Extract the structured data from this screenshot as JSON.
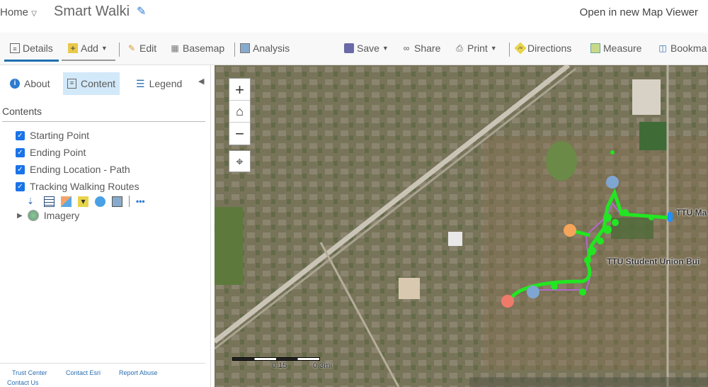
{
  "header": {
    "home": "Home",
    "title": "Smart Walki",
    "open_viewer": "Open in new Map Viewer"
  },
  "toolbar": {
    "details": "Details",
    "add": "Add",
    "edit": "Edit",
    "basemap": "Basemap",
    "analysis": "Analysis",
    "save": "Save",
    "share": "Share",
    "print": "Print",
    "directions": "Directions",
    "measure": "Measure",
    "bookmarks": "Bookma"
  },
  "sidebar": {
    "tabs": [
      "About",
      "Content",
      "Legend"
    ],
    "contents_heading": "Contents",
    "layers": [
      "Starting Point",
      "Ending Point",
      "Ending Location - Path",
      "Tracking Walking Routes"
    ],
    "basemap_layer": "Imagery",
    "footer": [
      "Trust Center",
      "Contact Esri",
      "Report Abuse",
      "Contact Us"
    ]
  },
  "map": {
    "labels": [
      "TTU Ma",
      "TTU Student Union Bui"
    ],
    "scale": {
      "mid": "0.15",
      "end": "0.3mi"
    },
    "colors": {
      "route": "#22e622",
      "start": "#f07a6a",
      "end": "#f5a55a",
      "point": "#7fa6d0",
      "path": "#b06ad0",
      "pin": "#1e90ff"
    }
  }
}
